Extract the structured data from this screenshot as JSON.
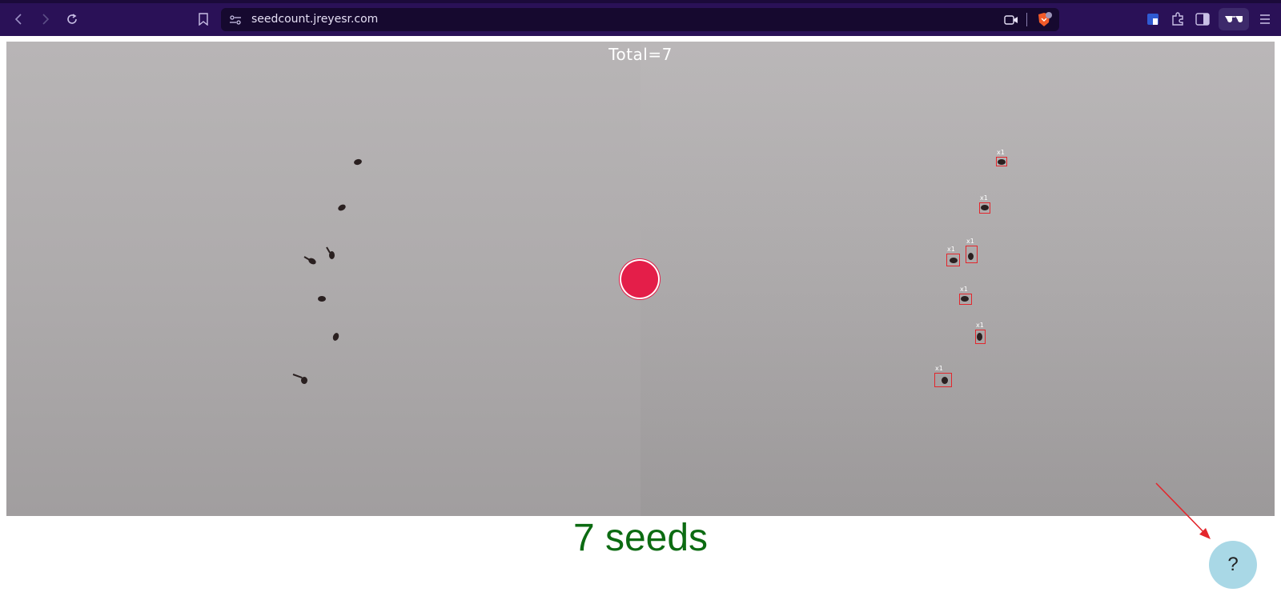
{
  "browser": {
    "url": "seedcount.jreyesr.com",
    "accent": "#2a1157",
    "icons": [
      "back-icon",
      "forward-icon",
      "reload-icon",
      "bookmark-icon",
      "site-info-icon",
      "camera-icon",
      "brave-shield-icon",
      "extension-shield-icon",
      "extensions-puzzle-icon",
      "sidebar-icon",
      "glasses-icon",
      "menu-icon"
    ]
  },
  "camera_view": {
    "overlay_text": "Total=7",
    "seeds": [
      {
        "label": "x1"
      },
      {
        "label": "x1"
      },
      {
        "label": "x1"
      },
      {
        "label": "x1"
      },
      {
        "label": "x1"
      },
      {
        "label": "x1"
      },
      {
        "label": "x1"
      }
    ],
    "box_color": "#e3262c",
    "record_color": "#e41e49"
  },
  "result": {
    "text": "7 seeds",
    "color": "#0c6b12"
  },
  "help": {
    "label": "?",
    "color": "#a9d8e6"
  }
}
